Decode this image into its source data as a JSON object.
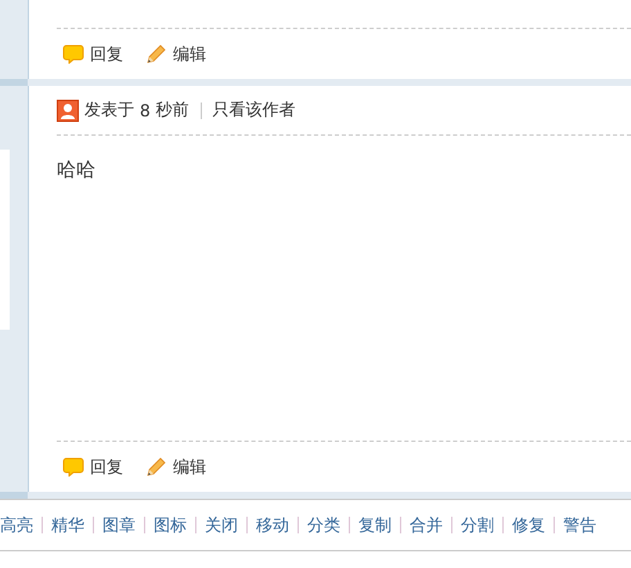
{
  "top_actions": [
    {
      "kind": "reply",
      "label": "回复"
    },
    {
      "kind": "edit",
      "label": "编辑"
    }
  ],
  "post": {
    "posted_label": "发表于",
    "time_number": "8",
    "time_unit": "秒前",
    "author_only_link": "只看该作者",
    "content": "哈哈"
  },
  "bottom_actions": [
    {
      "kind": "reply",
      "label": "回复"
    },
    {
      "kind": "edit",
      "label": "编辑"
    }
  ],
  "moderation_links": [
    "高亮",
    "精华",
    "图章",
    "图标",
    "关闭",
    "移动",
    "分类",
    "复制",
    "合并",
    "分割",
    "修复",
    "警告"
  ]
}
